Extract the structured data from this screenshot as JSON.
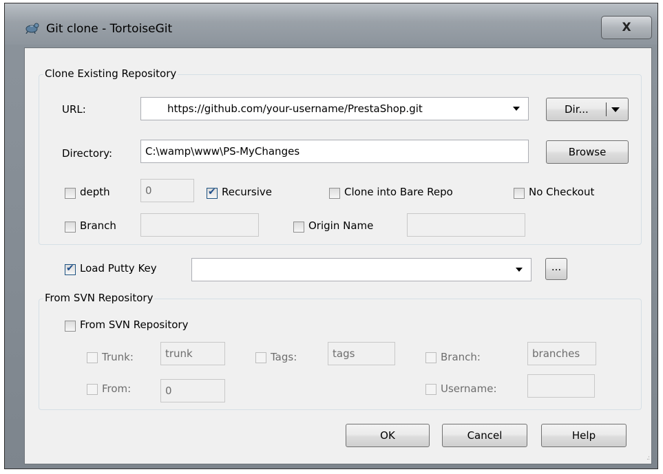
{
  "window": {
    "title": "Git clone - TortoiseGit",
    "close_label": "X"
  },
  "clone_group": {
    "legend": "Clone Existing Repository",
    "url_label": "URL:",
    "url_value": "https://github.com/your-username/PrestaShop.git",
    "dir_button": "Dir...",
    "directory_label": "Directory:",
    "directory_value": "C:\\wamp\\www\\PS-MyChanges",
    "browse_button": "Browse",
    "depth_label": "depth",
    "depth_checked": false,
    "depth_value": "0",
    "recursive_label": "Recursive",
    "recursive_checked": true,
    "bare_label": "Clone into Bare Repo",
    "bare_checked": false,
    "no_checkout_label": "No Checkout",
    "no_checkout_checked": false,
    "branch_label": "Branch",
    "branch_checked": false,
    "branch_value": "",
    "origin_label": "Origin Name",
    "origin_checked": false,
    "origin_value": ""
  },
  "putty": {
    "label": "Load Putty Key",
    "checked": true,
    "value": "",
    "browse_button": "..."
  },
  "svn_group": {
    "legend": "From SVN Repository",
    "checkbox_label": "From SVN Repository",
    "checked": false,
    "trunk_label": "Trunk:",
    "trunk_value": "trunk",
    "tags_label": "Tags:",
    "tags_value": "tags",
    "branch_label": "Branch:",
    "branch_value": "branches",
    "from_label": "From:",
    "from_value": "0",
    "username_label": "Username:",
    "username_value": ""
  },
  "buttons": {
    "ok": "OK",
    "cancel": "Cancel",
    "help": "Help"
  }
}
